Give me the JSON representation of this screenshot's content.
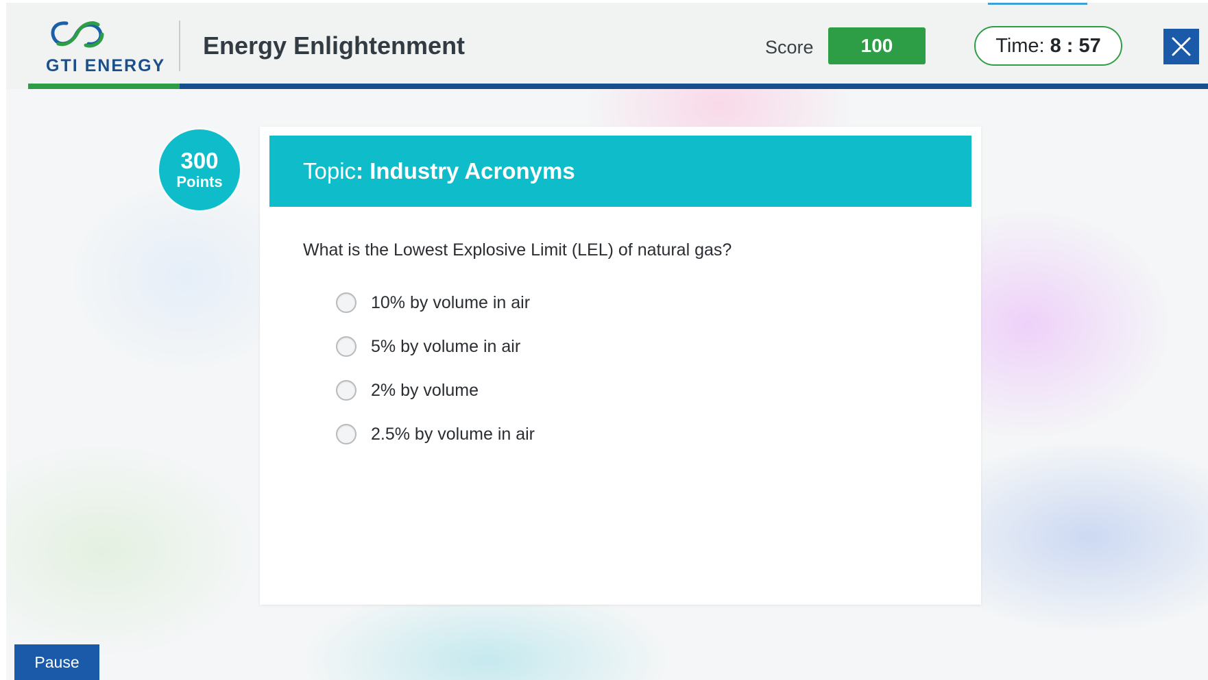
{
  "header": {
    "logo_text": "GTI ENERGY",
    "app_title": "Energy Enlightenment",
    "score_label": "Score",
    "score_value": "100",
    "timer_label": "Time:",
    "timer_value": "8 : 57"
  },
  "question_card": {
    "points_value": "300",
    "points_label": "Points",
    "topic_label": "Topic",
    "topic_name": ": Industry Acronyms",
    "question": "What is the Lowest Explosive Limit (LEL) of natural gas?",
    "options": [
      {
        "label": "10% by volume in air",
        "selected": false
      },
      {
        "label": "5% by volume in air",
        "selected": false
      },
      {
        "label": "2% by volume",
        "selected": false
      },
      {
        "label": "2.5% by volume in air",
        "selected": false
      }
    ]
  },
  "footer": {
    "pause_label": "Pause"
  },
  "colors": {
    "brand_blue": "#1a5aa8",
    "brand_green": "#2e9e46",
    "teal": "#0fbcc9"
  },
  "icons": [
    "gti-logo-icon",
    "close-icon"
  ]
}
